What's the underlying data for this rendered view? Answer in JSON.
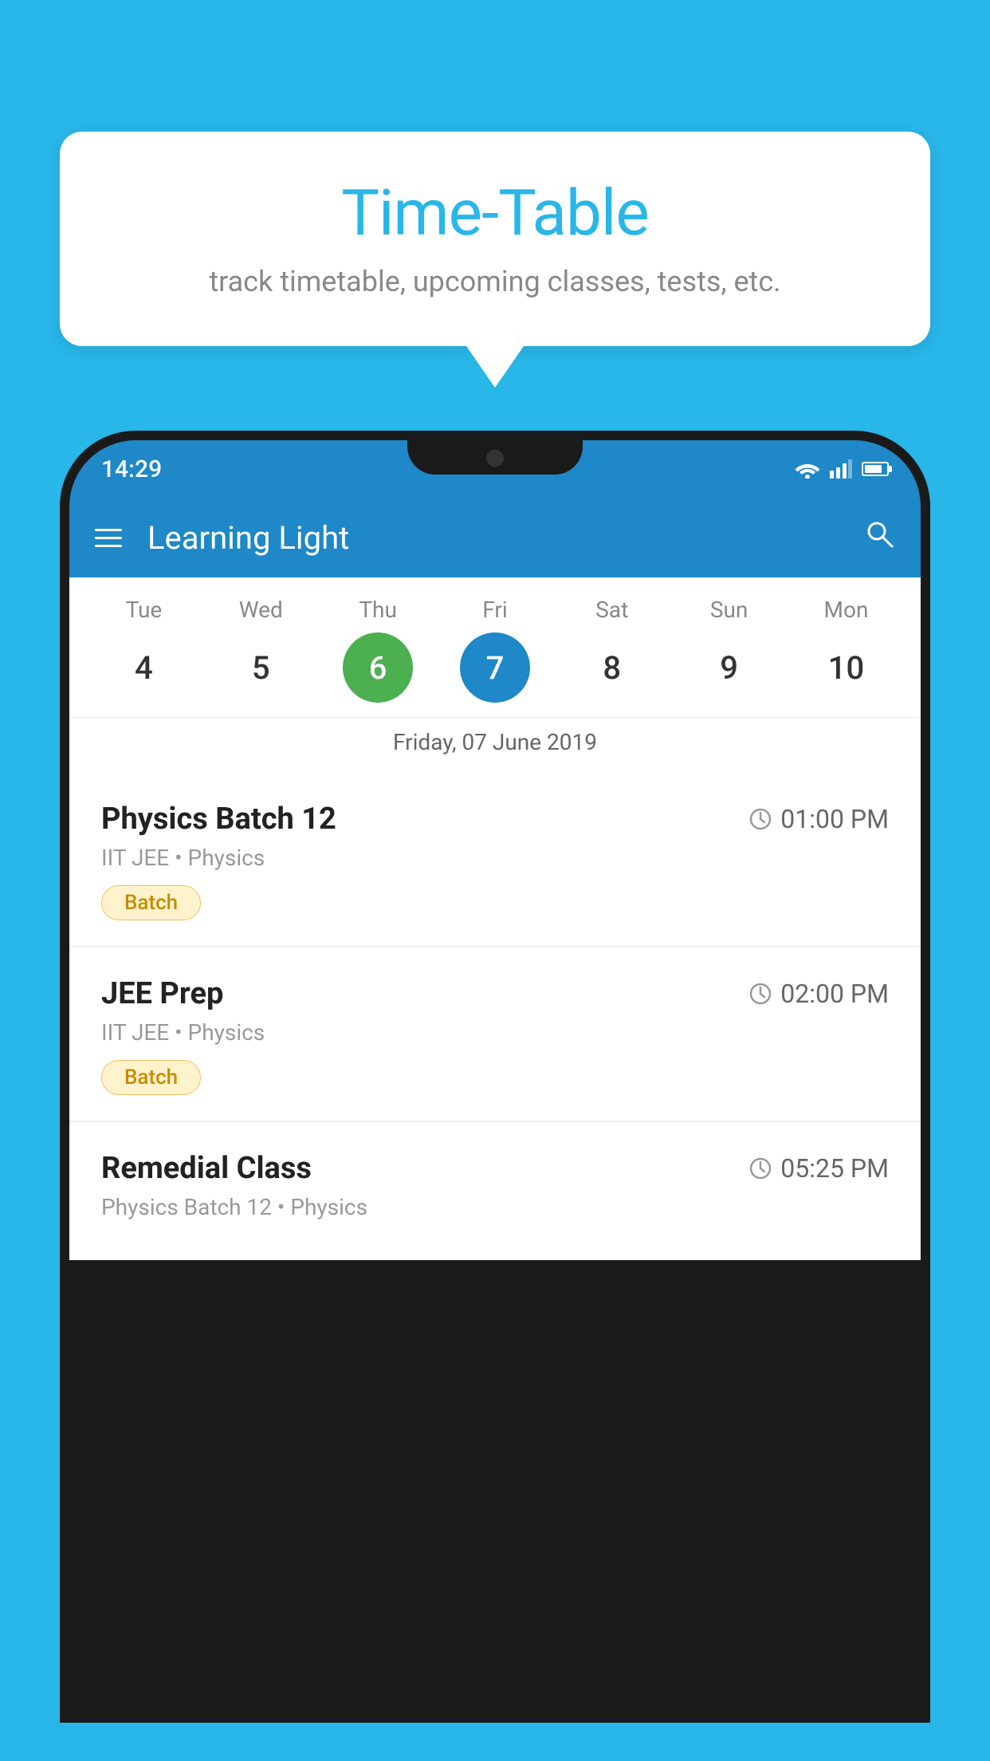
{
  "background_color": "#29b6e8",
  "bubble": {
    "title": "Time-Table",
    "subtitle": "track timetable, upcoming classes, tests, etc."
  },
  "status_bar": {
    "time": "14:29"
  },
  "app_bar": {
    "title": "Learning Light",
    "menu_icon": "hamburger-icon",
    "search_icon": "search-icon"
  },
  "calendar": {
    "days": [
      {
        "label": "Tue",
        "number": "4"
      },
      {
        "label": "Wed",
        "number": "5"
      },
      {
        "label": "Thu",
        "number": "6",
        "state": "today"
      },
      {
        "label": "Fri",
        "number": "7",
        "state": "selected"
      },
      {
        "label": "Sat",
        "number": "8"
      },
      {
        "label": "Sun",
        "number": "9"
      },
      {
        "label": "Mon",
        "number": "10"
      }
    ],
    "selected_date_label": "Friday, 07 June 2019"
  },
  "schedule": [
    {
      "title": "Physics Batch 12",
      "time": "01:00 PM",
      "meta": "IIT JEE • Physics",
      "badge": "Batch"
    },
    {
      "title": "JEE Prep",
      "time": "02:00 PM",
      "meta": "IIT JEE • Physics",
      "badge": "Batch"
    },
    {
      "title": "Remedial Class",
      "time": "05:25 PM",
      "meta": "Physics Batch 12 • Physics",
      "badge": null
    }
  ]
}
